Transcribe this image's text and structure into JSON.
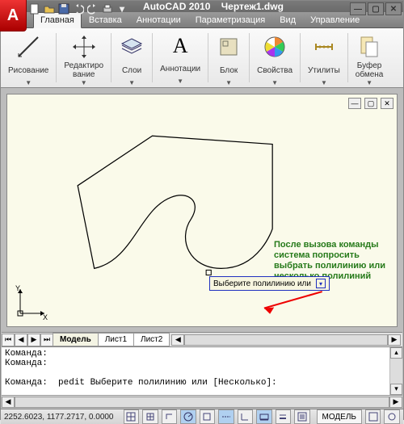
{
  "title": {
    "app": "AutoCAD 2010",
    "doc": "Чертеж1.dwg"
  },
  "qat_icons": [
    "new",
    "open",
    "save",
    "undo",
    "redo",
    "print",
    "menu"
  ],
  "tabs": [
    {
      "label": "Главная",
      "active": true
    },
    {
      "label": "Вставка",
      "active": false
    },
    {
      "label": "Аннотации",
      "active": false
    },
    {
      "label": "Параметризация",
      "active": false
    },
    {
      "label": "Вид",
      "active": false
    },
    {
      "label": "Управление",
      "active": false
    }
  ],
  "ribbon": [
    {
      "label": "Рисование",
      "icon": "line"
    },
    {
      "label": "Редактиро\nвание",
      "icon": "move"
    },
    {
      "label": "Слои",
      "icon": "layers"
    },
    {
      "label": "Аннотации",
      "icon": "A"
    },
    {
      "label": "Блок",
      "icon": "block"
    },
    {
      "label": "Свойства",
      "icon": "palette"
    },
    {
      "label": "Утилиты",
      "icon": "measure"
    },
    {
      "label": "Буфер\nобмена",
      "icon": "clip"
    }
  ],
  "annotation_text": "После вызова команды система попросить выбрать полилинию или несколько полилиний",
  "prompt": "Выберите полилинию или",
  "layout_tabs": [
    {
      "label": "Модель",
      "active": true
    },
    {
      "label": "Лист1",
      "active": false
    },
    {
      "label": "Лист2",
      "active": false
    }
  ],
  "cmd_lines": [
    "Команда:",
    "Команда:",
    "",
    "Команда:  pedit Выберите полилинию или [Несколько]:"
  ],
  "status": {
    "coords": "2252.6023, 1177.2717, 0.0000",
    "model_label": "МОДЕЛЬ"
  },
  "axes": {
    "y": "Y",
    "x": "X"
  }
}
